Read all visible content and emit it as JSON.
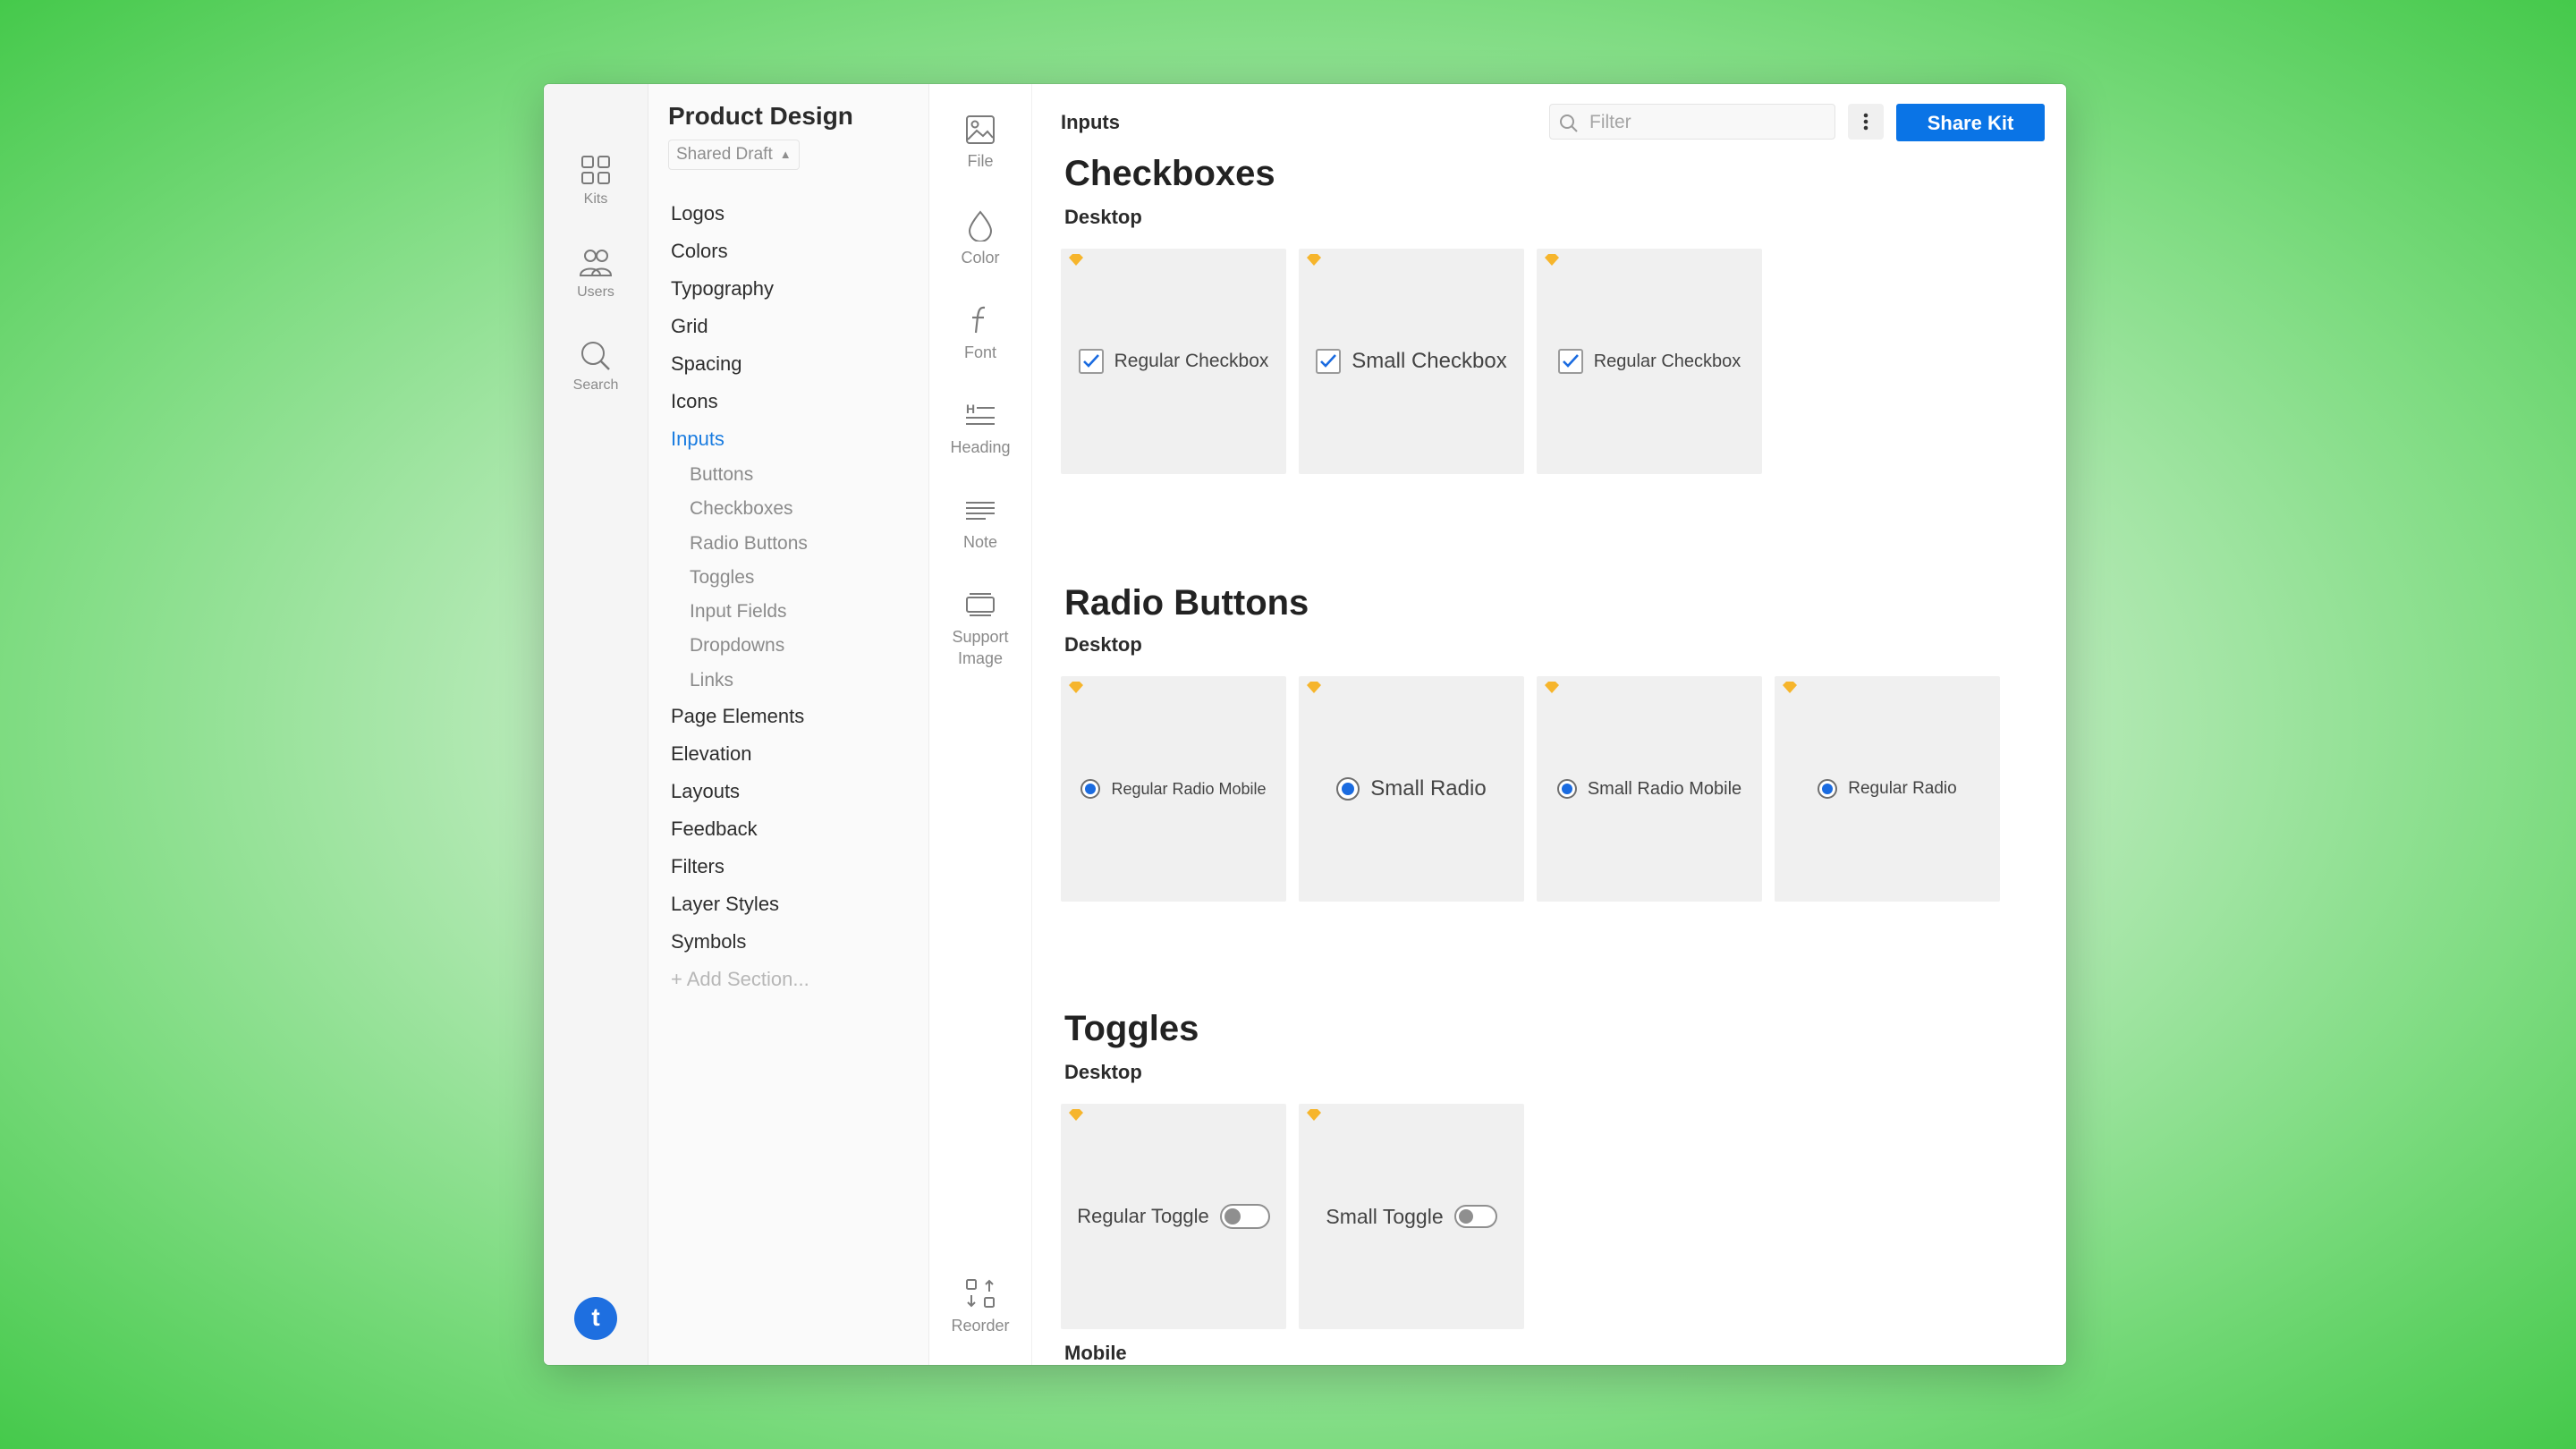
{
  "project": {
    "title": "Product Design",
    "draft_label": "Shared Draft"
  },
  "rail": {
    "kits": "Kits",
    "users": "Users",
    "search": "Search",
    "avatar_letter": "t"
  },
  "nav": {
    "items": [
      "Logos",
      "Colors",
      "Typography",
      "Grid",
      "Spacing",
      "Icons"
    ],
    "active": "Inputs",
    "sub_items": [
      "Buttons",
      "Checkboxes",
      "Radio Buttons",
      "Toggles",
      "Input Fields",
      "Dropdowns",
      "Links"
    ],
    "items_after": [
      "Page Elements",
      "Elevation",
      "Layouts",
      "Feedback",
      "Filters",
      "Layer Styles",
      "Symbols"
    ],
    "add_section": "Add Section..."
  },
  "tools": {
    "file": "File",
    "color": "Color",
    "font": "Font",
    "heading": "Heading",
    "note": "Note",
    "support_line1": "Support",
    "support_line2": "Image",
    "reorder": "Reorder"
  },
  "header": {
    "breadcrumb": "Inputs",
    "filter_placeholder": "Filter",
    "share_label": "Share Kit"
  },
  "sections": {
    "checkboxes": {
      "title": "Checkboxes",
      "subtitle": "Desktop",
      "cards": [
        "Regular Checkbox",
        "Small Checkbox",
        "Regular Checkbox"
      ]
    },
    "radios": {
      "title": "Radio Buttons",
      "subtitle": "Desktop",
      "cards": [
        "Regular Radio Mobile",
        "Small Radio",
        "Small Radio Mobile",
        "Regular Radio"
      ]
    },
    "toggles": {
      "title": "Toggles",
      "subtitle": "Desktop",
      "cards": [
        "Regular Toggle",
        "Small Toggle"
      ],
      "next_subtitle": "Mobile"
    }
  },
  "colors": {
    "accent": "#0a74e6",
    "active_nav": "#1a7ce0",
    "gem": "#f6b52c",
    "radio_fill": "#1a6be0"
  }
}
